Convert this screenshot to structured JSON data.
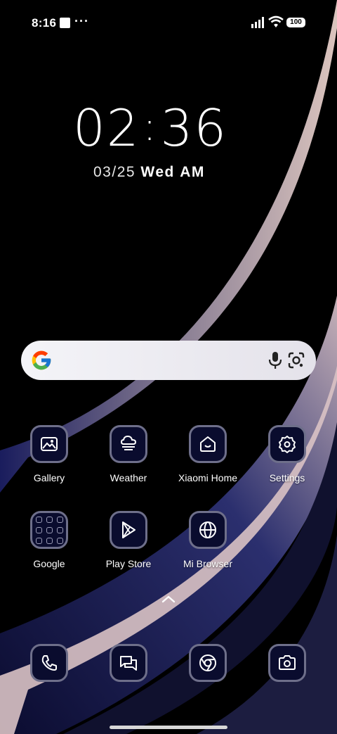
{
  "status_bar": {
    "time": "8:16",
    "more": "···",
    "battery": "100"
  },
  "clock": {
    "hh": "02",
    "sep": ":",
    "mm": "36",
    "date": "03/25",
    "weekday": "Wed",
    "ampm": "AM"
  },
  "search": {
    "logo": "google-g-icon",
    "mic": "mic-icon",
    "lens": "google-lens-icon"
  },
  "apps": [
    {
      "label": "Gallery",
      "icon": "gallery-icon"
    },
    {
      "label": "Weather",
      "icon": "weather-icon"
    },
    {
      "label": "Xiaomi Home",
      "icon": "xiaomi-home-icon"
    },
    {
      "label": "Settings",
      "icon": "gear-icon"
    },
    {
      "label": "Google",
      "icon": "folder-icon"
    },
    {
      "label": "Play Store",
      "icon": "play-store-icon"
    },
    {
      "label": "Mi Browser",
      "icon": "globe-icon"
    }
  ],
  "dock": [
    {
      "icon": "phone-icon"
    },
    {
      "icon": "messages-icon"
    },
    {
      "icon": "chrome-icon"
    },
    {
      "icon": "camera-icon"
    }
  ],
  "colors": {
    "icon_bg": "#0a0c2e",
    "icon_border": "#6e6f8a",
    "search_bg": "#eeeef3"
  }
}
